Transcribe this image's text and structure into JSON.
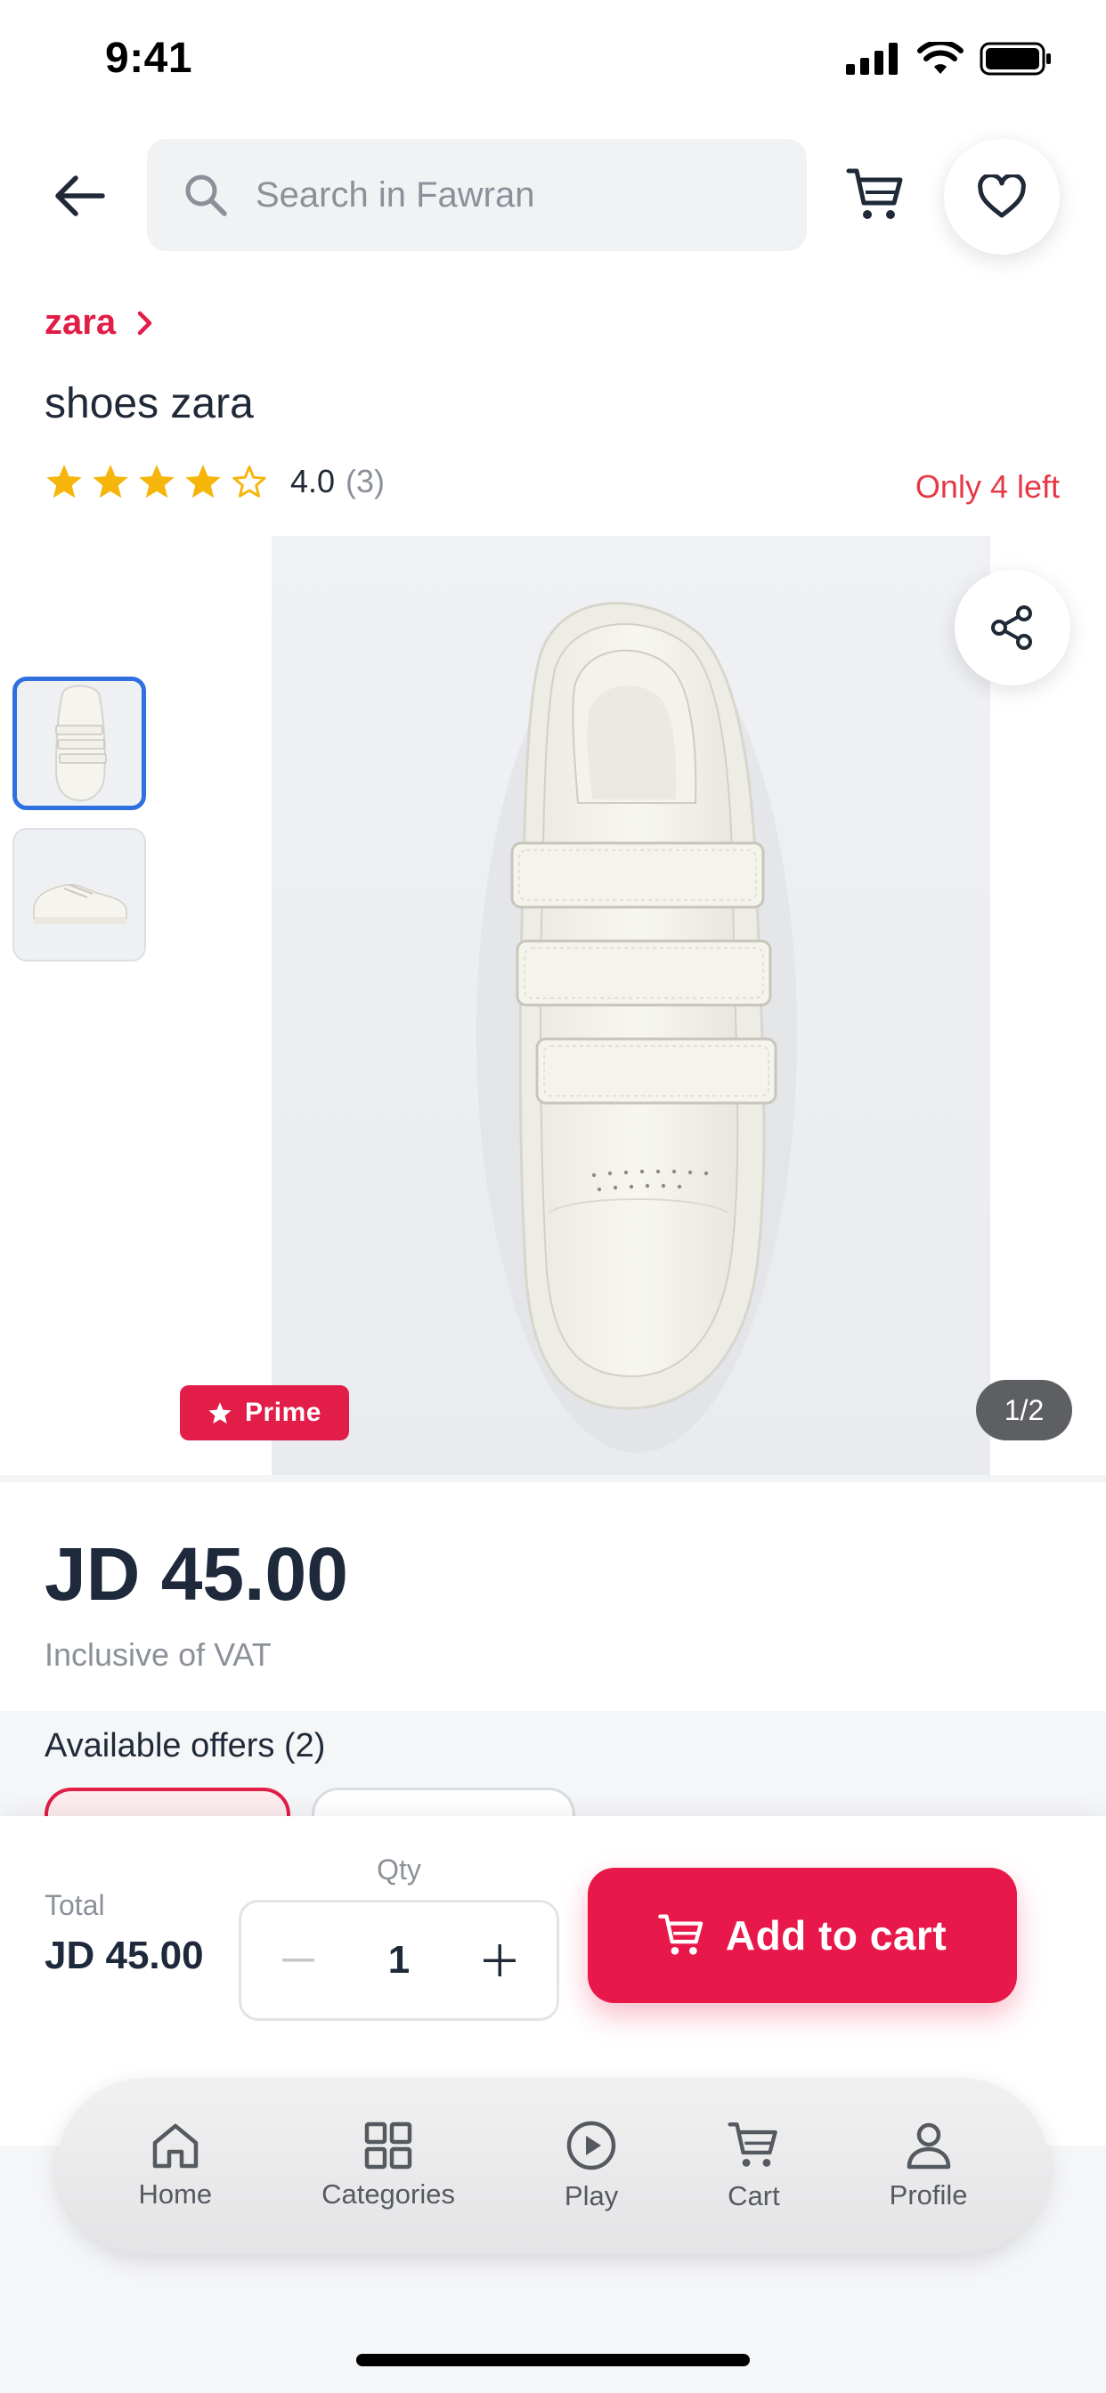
{
  "status_bar": {
    "time": "9:41"
  },
  "header": {
    "search_placeholder": "Search in Fawran"
  },
  "product": {
    "brand": "zara",
    "title": "shoes zara",
    "rating": "4.0",
    "rating_count": "(3)",
    "stars_filled": 4,
    "stars_total": 5,
    "stock_text": "Only 4 left",
    "badge": "Prime",
    "image_index": "1/2",
    "price": "JD 45.00",
    "vat_note": "Inclusive of VAT"
  },
  "offers": {
    "title": "Available offers (2)"
  },
  "purchase": {
    "total_label": "Total",
    "total_value": "JD 45.00",
    "qty_label": "Qty",
    "qty_value": "1",
    "add_to_cart": "Add to cart"
  },
  "tabbar": {
    "items": [
      {
        "label": "Home",
        "icon": "home-icon"
      },
      {
        "label": "Categories",
        "icon": "grid-icon"
      },
      {
        "label": "Play",
        "icon": "play-icon"
      },
      {
        "label": "Cart",
        "icon": "cart-icon"
      },
      {
        "label": "Profile",
        "icon": "user-icon"
      }
    ]
  },
  "colors": {
    "accent": "#e8194a",
    "brand_red": "#e11d48",
    "stock_red": "#e53945",
    "star": "#f5b50a",
    "thumb_active": "#2f6fe0"
  }
}
